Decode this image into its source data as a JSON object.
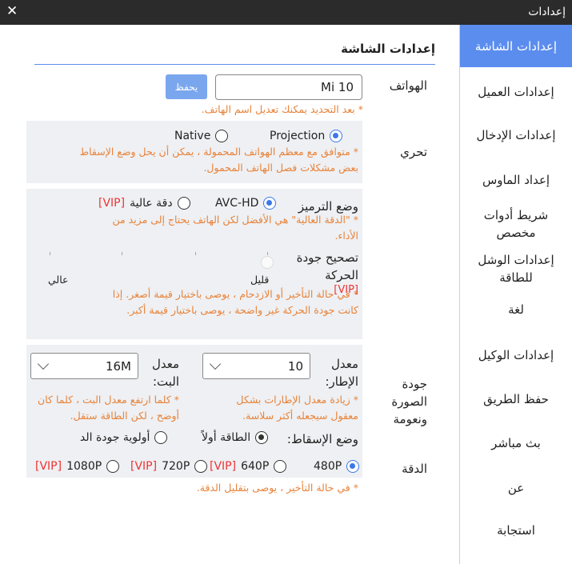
{
  "window": {
    "title": "إعدادات",
    "close_glyph": "✕"
  },
  "sidebar": {
    "items": [
      {
        "label": "إعدادات الشاشة",
        "active": true
      },
      {
        "label": "إعدادات العميل"
      },
      {
        "label": "إعدادات الإدخال"
      },
      {
        "label": "إعداد الماوس"
      },
      {
        "label": "شريط أدوات مخصص"
      },
      {
        "label": "إعدادات الوشل للطاقة"
      },
      {
        "label": "لغة"
      },
      {
        "label": "إعدادات الوكيل"
      },
      {
        "label": "حفظ الطريق"
      },
      {
        "label": "بث مباشر"
      },
      {
        "label": "عن"
      },
      {
        "label": "استجابة"
      }
    ]
  },
  "main": {
    "title": "إعدادات الشاشة",
    "phones": {
      "label": "الهواتف",
      "value": "Mi 10",
      "save": "يحفظ",
      "note": "* بعد التحديد يمكنك تعديل اسم الهاتف."
    },
    "trial": {
      "label": "تحري",
      "option_projection": "Projection",
      "option_native": "Native",
      "selected": "Projection",
      "note": "* متوافق مع معظم الهواتف المحمولة ، يمكن أن يحل وضع الإسقاط بعض مشكلات فصل الهاتف المحمول."
    },
    "encoding": {
      "label": "وضع الترميز",
      "option_avc": "AVC-HD",
      "option_high": "دقة عالية",
      "high_vip": "[VIP]",
      "selected": "AVC-HD",
      "note": "* \"الدقة العالية\" هي الأفضل لكن الهاتف يحتاج إلى مزيد من الأداء."
    },
    "motion": {
      "label": "تصحيح جودة الحركة",
      "vip": "[VIP]",
      "low": "قليل",
      "high": "عالي",
      "level": 0,
      "note": "* في حالة التأخير أو الازدحام ، يوصى باختيار قيمة أصغر. إذا كانت جودة الحركة غير واضحة ، يوصى باختيار قيمة أكبر."
    },
    "quality": {
      "label": "جودة الصورة ونعومة",
      "framerate_label": "معدل الإطار:",
      "framerate_value": "10",
      "framerate_note": "* زيادة معدل الإطارات بشكل معقول سيجعله أكثر سلاسة.",
      "bitrate_label": "معدل البت:",
      "bitrate_value": "16M",
      "bitrate_note": "* كلما ارتفع معدل البت ، كلما كان أوضح ، لكن الطاقة ستقل.",
      "projection_mode_label": "وضع الإسقاط:",
      "mode_energy": "الطاقة أولاً",
      "mode_quality": "أولوية جودة الد",
      "selected_mode": "الطاقة أولاً"
    },
    "resolution": {
      "label": "الدقة",
      "options": [
        {
          "label": "480P",
          "vip": "",
          "selected": true
        },
        {
          "label": "640P",
          "vip": "[VIP]",
          "selected": false
        },
        {
          "label": "720P",
          "vip": "[VIP]",
          "selected": false
        },
        {
          "label": "1080P",
          "vip": "[VIP]",
          "selected": false
        }
      ],
      "note": "* في حالة التأخير ، يوصى بتقليل الدقة."
    }
  },
  "colors": {
    "accent": "#5b8def",
    "note": "#e8833a",
    "vip": "#e33333",
    "panel": "#eef0f3",
    "titlebar": "#2b2b2b"
  }
}
